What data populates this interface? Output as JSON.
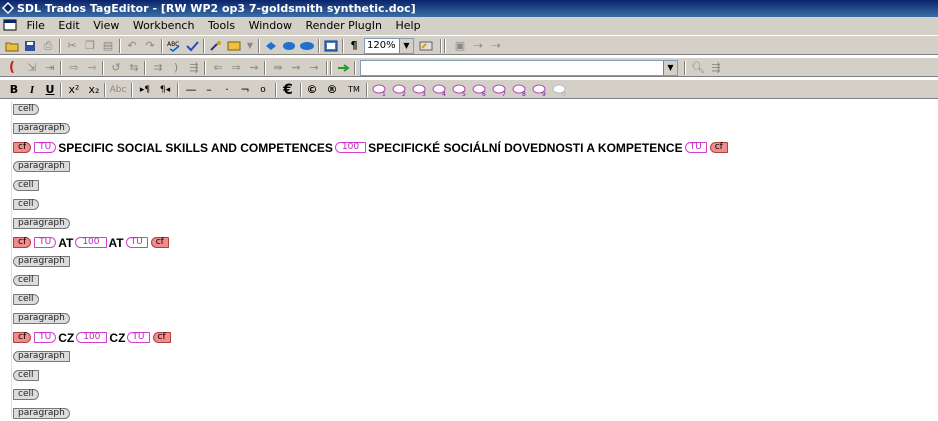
{
  "window": {
    "title": "SDL Trados TagEditor - [RW WP2 op3 7-goldsmith synthetic.doc]"
  },
  "menu": [
    "File",
    "Edit",
    "View",
    "Workbench",
    "Tools",
    "Window",
    "Render PlugIn",
    "Help"
  ],
  "toolbar1": {
    "zoom": "120%"
  },
  "toolbar3": {
    "bold": "B",
    "italic": "I",
    "underline": "U",
    "sup": "x²",
    "sub": "x₂",
    "abc": "Abc",
    "dash_long": "—",
    "dash_mid": "–",
    "dot": "·",
    "not": "¬",
    "deg": "o",
    "euro": "€",
    "copyright": "©",
    "registered": "®",
    "trademark": "TM"
  },
  "document": {
    "tags": {
      "cell": "cell",
      "paragraph": "paragraph",
      "cf": "cf",
      "tu": "TU",
      "match": "100"
    },
    "segments": [
      {
        "source": "SPECIFIC SOCIAL SKILLS AND COMPETENCES",
        "target": "SPECIFICKÉ SOCIÁLNÍ DOVEDNOSTI A KOMPETENCE"
      },
      {
        "source": "AT",
        "target": "AT"
      },
      {
        "source": "CZ",
        "target": "CZ"
      }
    ]
  }
}
